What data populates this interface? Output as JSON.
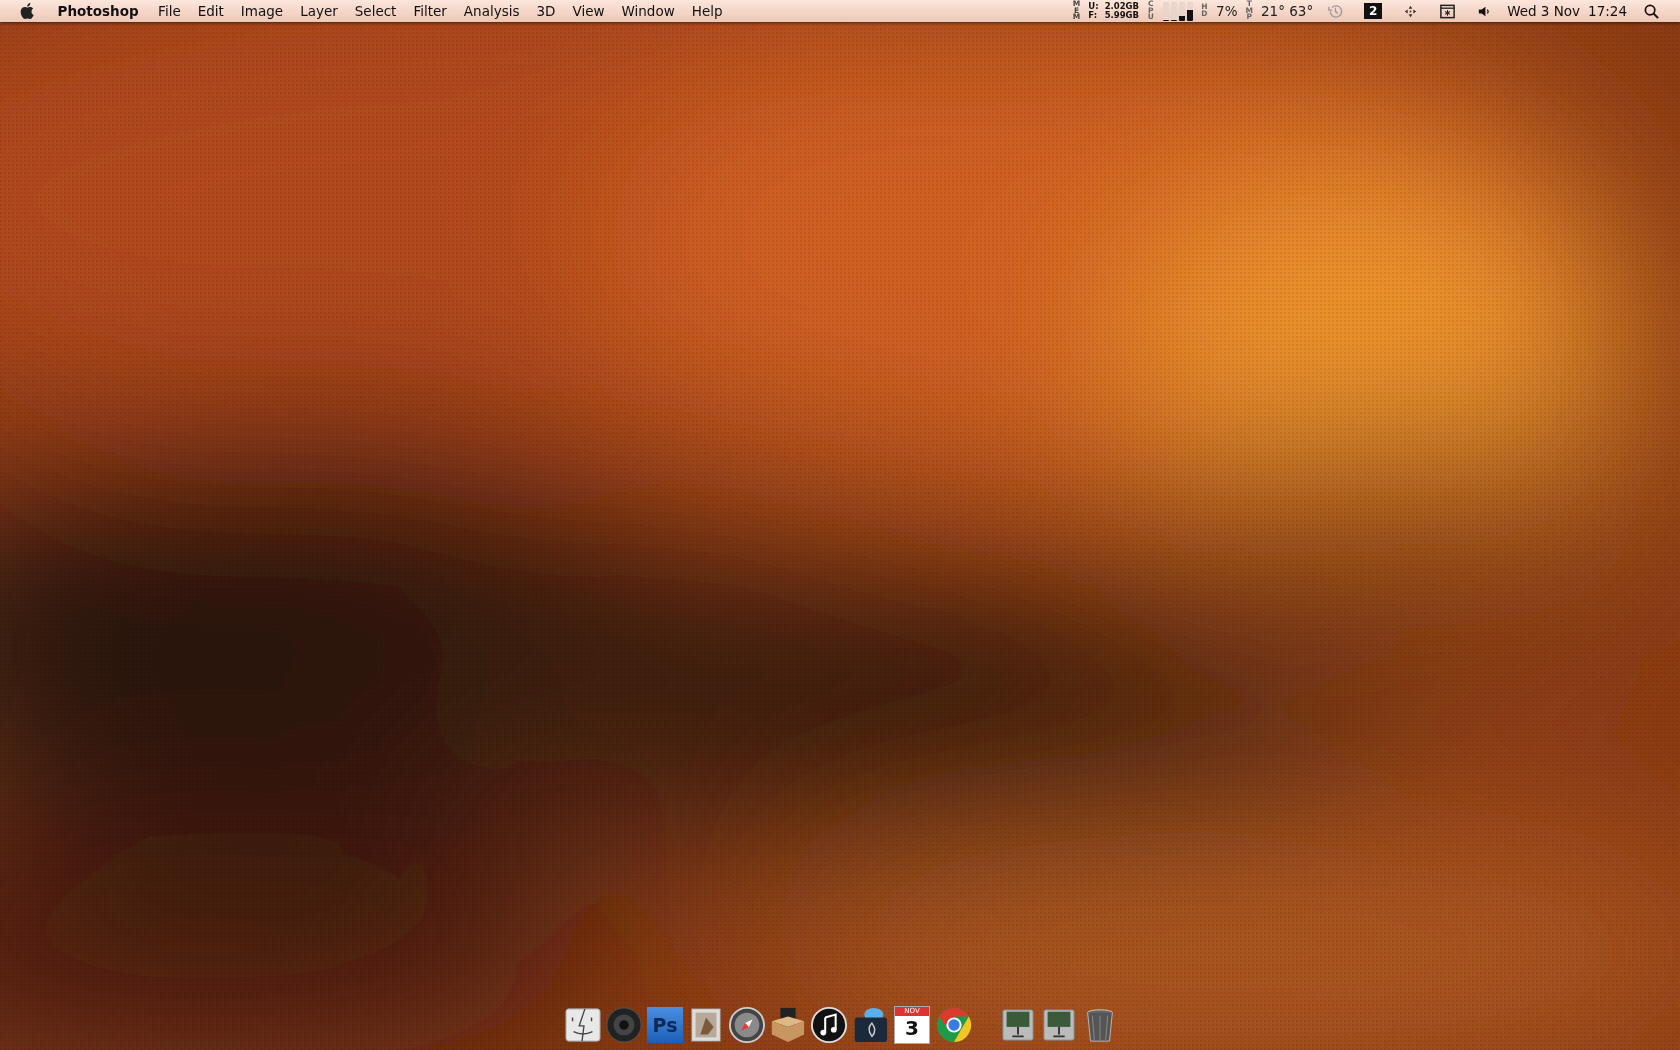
{
  "menu_bar": {
    "app_name": "Photoshop",
    "menus": [
      "File",
      "Edit",
      "Image",
      "Layer",
      "Select",
      "Filter",
      "Analysis",
      "3D",
      "View",
      "Window",
      "Help"
    ],
    "memory": {
      "label": "MEM",
      "used_label": "U:",
      "used": "2.02GB",
      "free_label": "F:",
      "free": "5.99GB"
    },
    "cpu": {
      "label": "CPU",
      "cores": [
        {
          "level": 0
        },
        {
          "level": 0
        },
        {
          "level": 0.25
        },
        {
          "level": 0.55
        }
      ]
    },
    "disk": {
      "label": "HD",
      "value": "7%"
    },
    "temperature": {
      "label": "TMP",
      "value": "21° 63°"
    },
    "spaces": "2",
    "date": "Wed 3 Nov",
    "time": "17:24"
  },
  "dock": {
    "items": [
      {
        "kind": "finder"
      },
      {
        "kind": "speaker"
      },
      {
        "kind": "photoshop",
        "label": "Ps"
      },
      {
        "kind": "mail"
      },
      {
        "kind": "safari"
      },
      {
        "kind": "package"
      },
      {
        "kind": "itunes"
      },
      {
        "kind": "burn"
      },
      {
        "kind": "calendar",
        "month": "NOV",
        "day": "3"
      },
      {
        "kind": "chrome"
      },
      {
        "kind": "separator"
      },
      {
        "kind": "drive"
      },
      {
        "kind": "drive"
      },
      {
        "kind": "trash"
      }
    ]
  }
}
